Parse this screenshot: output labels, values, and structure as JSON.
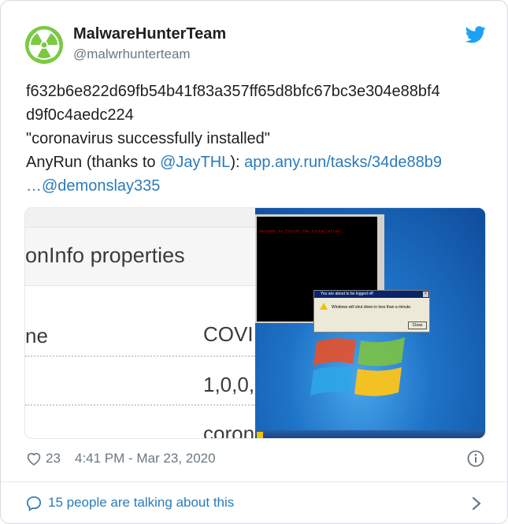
{
  "author": {
    "name": "MalwareHunterTeam",
    "handle": "@malwrhunterteam",
    "avatar_icon": "radioactive-icon",
    "avatar_color": "#7ac943"
  },
  "tweet": {
    "hash_line1": "f632b6e822d69fb54b41f83a357ff65d8bfc67bc3e304e88bf4",
    "hash_line2": "d9f0c4aedc224",
    "quote": "\"coronavirus successfully installed\"",
    "anyrun_prefix": "AnyRun (thanks to ",
    "mention_jaythl": "@JayTHL",
    "anyrun_mid": "): ",
    "anyrun_link": "app.any.run/tasks/34de88b9",
    "ellipsis_mention": "…@demonslay335"
  },
  "media": {
    "left": {
      "title": "onInfo properties",
      "row_label": "ne",
      "values": [
        "COVI",
        "1,0,0,",
        "coron"
      ]
    },
    "right": {
      "console_text": "Seconds to finish the installation..",
      "dialog_title": "You are about to be logged off",
      "dialog_message": "Windows will shut down in less than a minute.",
      "dialog_button": "Close"
    }
  },
  "footer": {
    "likes": "23",
    "timestamp": "4:41 PM - Mar 23, 2020",
    "talking": "15 people are talking about this"
  },
  "colors": {
    "link": "#2b7bb9",
    "muted": "#697882",
    "twitter_blue": "#1da1f2"
  }
}
